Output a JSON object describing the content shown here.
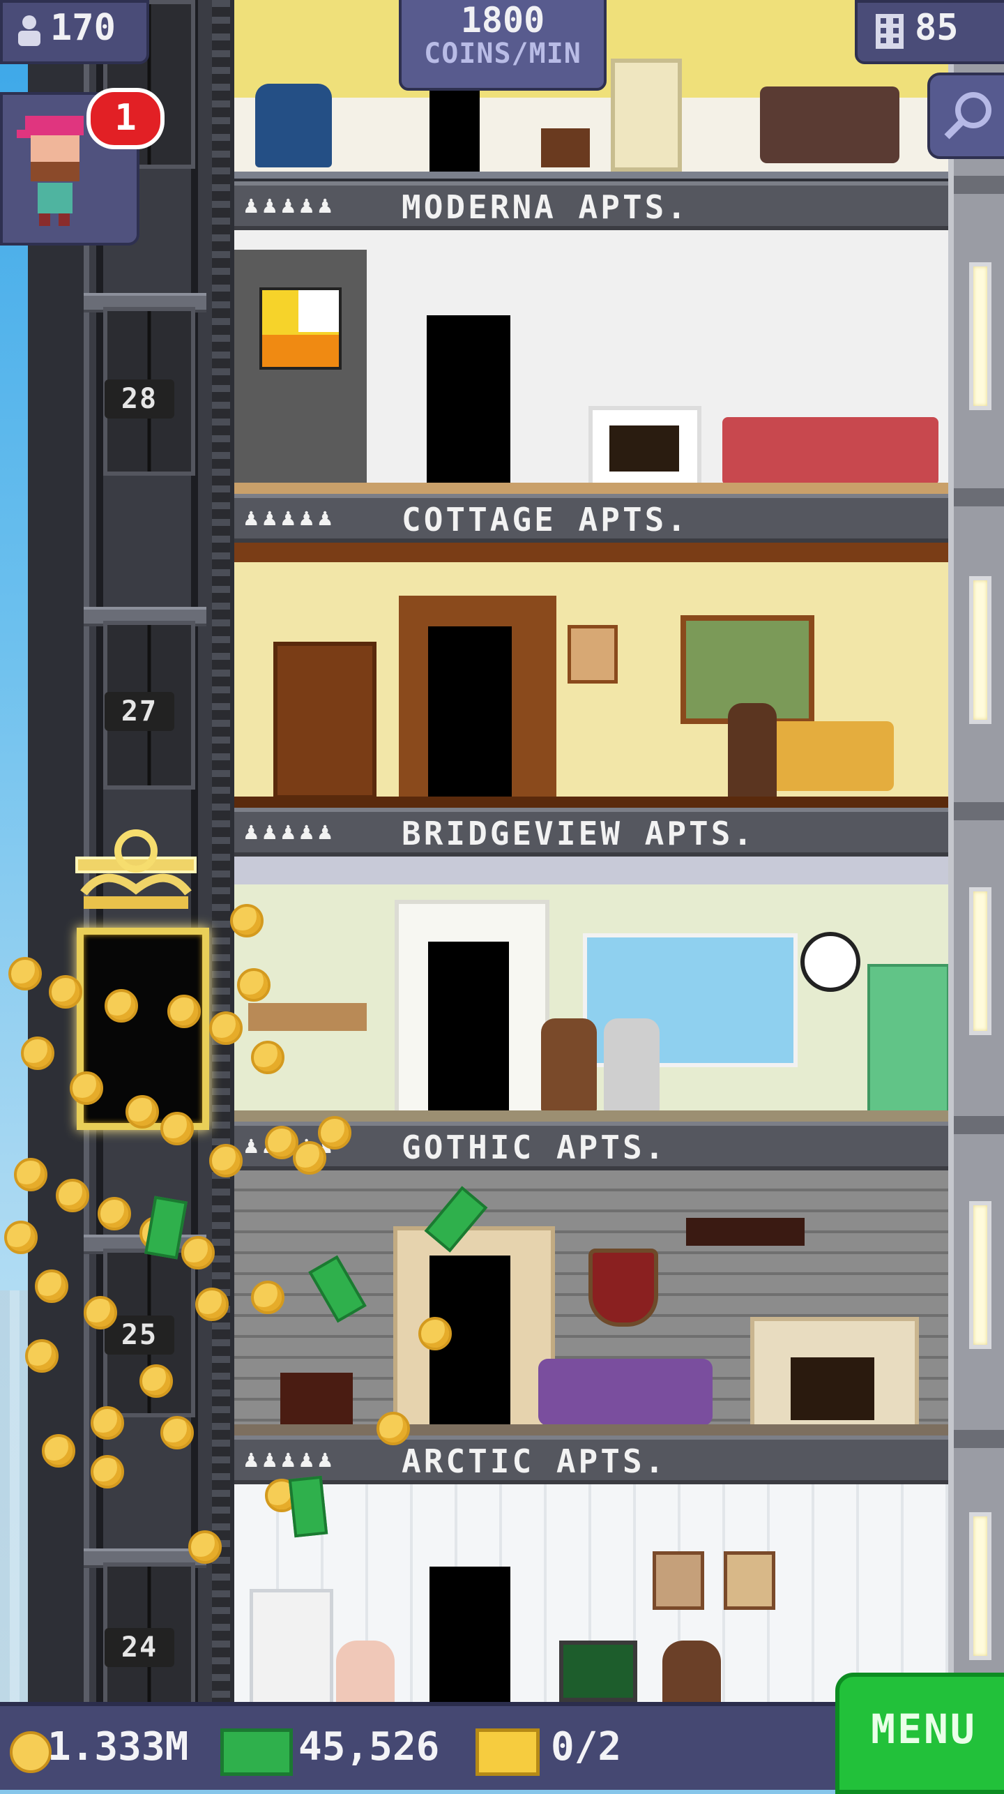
{
  "hud": {
    "population": "170",
    "coins_per_min_value": "1800",
    "coins_per_min_label": "COINS/MIN",
    "floors_count": "85",
    "notification_count": "1"
  },
  "floors": [
    {
      "name": "MODERNA APTS.",
      "people": "♟♟♟♟♟"
    },
    {
      "name": "COTTAGE APTS.",
      "people": "♟♟♟♟♟"
    },
    {
      "name": "BRIDGEVIEW APTS.",
      "people": "♟♟♟♟♟"
    },
    {
      "name": "GOTHIC APTS.",
      "people": "♟♟♟♟♟"
    },
    {
      "name": "ARCTIC APTS.",
      "people": "♟♟♟♟♟"
    }
  ],
  "elevator_floor_numbers": [
    "28",
    "27",
    "25",
    "24"
  ],
  "bottom_bar": {
    "coins": "1.333M",
    "bux": "45,526",
    "vip": "0/2",
    "menu_label": "MENU"
  },
  "colors": {
    "hud_bg": "#4a4c78",
    "menu_green": "#22c13a",
    "gold": "#e9cf58",
    "badge_red": "#e22025"
  },
  "icons": {
    "population": "person-icon",
    "floors": "building-icon",
    "zoom": "magnifier-icon",
    "coins": "coin-icon",
    "bux": "bux-icon",
    "vip": "vip-ticket-icon"
  }
}
